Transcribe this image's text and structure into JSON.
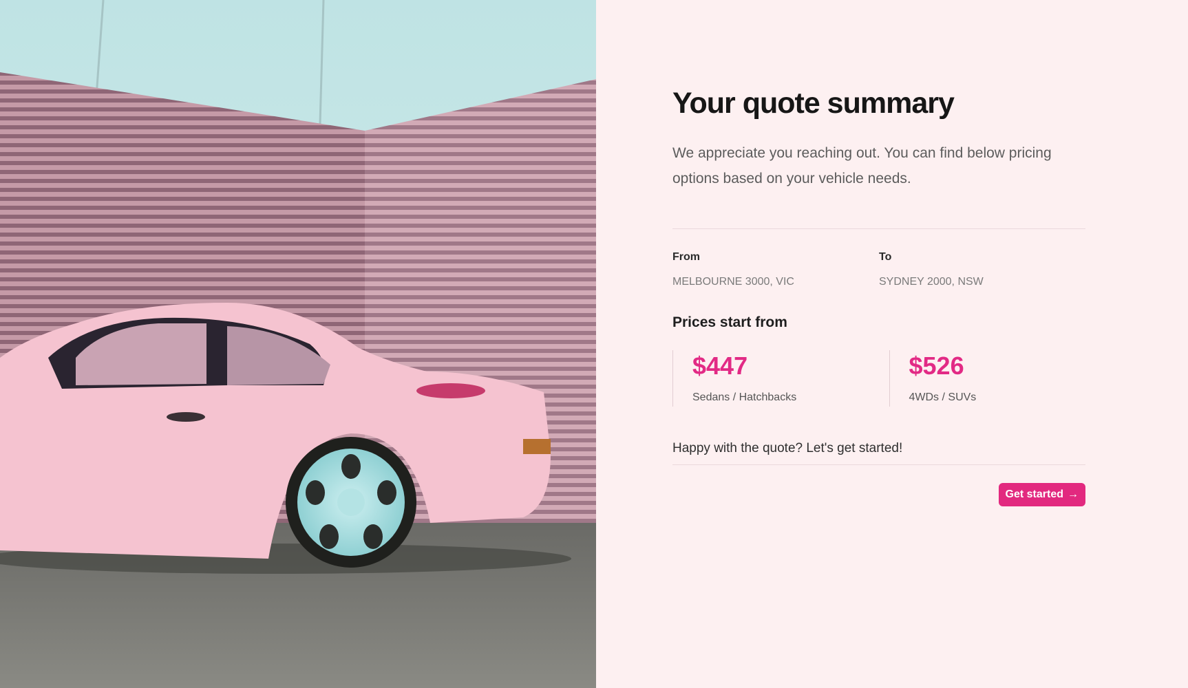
{
  "hero": {
    "image": "pink-classic-sports-car-photo",
    "alt_visible": ""
  },
  "quote": {
    "title": "Your quote summary",
    "intro": "We appreciate you reaching out. You can find below pricing options based on your vehicle needs.",
    "from_label": "From",
    "from_value": "MELBOURNE 3000, VIC",
    "to_label": "To",
    "to_value": "SYDNEY 2000, NSW",
    "prices_heading": "Prices start from",
    "prices": [
      {
        "amount": "$447",
        "type": "Sedans / Hatchbacks"
      },
      {
        "amount": "$526",
        "type": "4WDs / SUVs"
      }
    ],
    "happy_text": "Happy with the quote? Let's get started!",
    "cta_label": "Get started",
    "cta_icon": "arrow-right-icon",
    "cta_arrow": "→"
  },
  "colors": {
    "accent": "#e22a85",
    "panel_bg": "#fdf0f1",
    "title": "#161616"
  }
}
